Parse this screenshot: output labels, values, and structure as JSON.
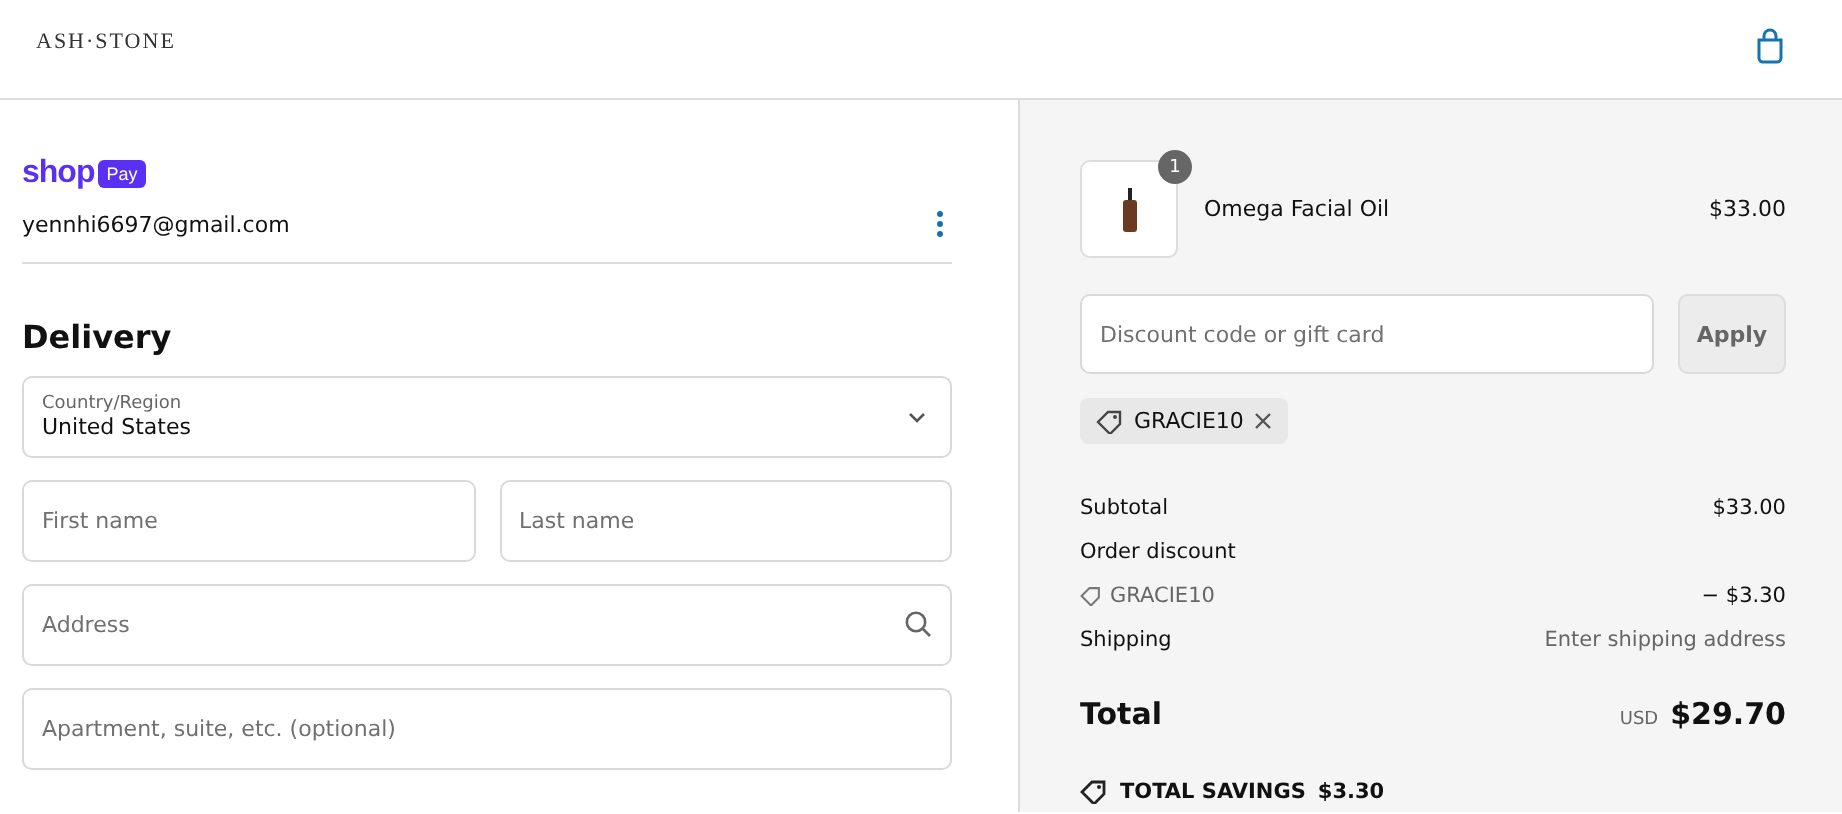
{
  "header": {
    "logo": "ASH·STONE"
  },
  "account": {
    "wallet_word": "shop",
    "wallet_badge": "Pay",
    "email": "yennhi6697@gmail.com"
  },
  "delivery": {
    "title": "Delivery",
    "fields": [
      {
        "kind": "select",
        "label": "Country/Region",
        "value": "United States"
      },
      {
        "kind": "pair",
        "items": [
          {
            "placeholder": "First name"
          },
          {
            "placeholder": "Last name"
          }
        ]
      },
      {
        "kind": "search",
        "placeholder": "Address"
      },
      {
        "kind": "text",
        "placeholder": "Apartment, suite, etc. (optional)"
      }
    ]
  },
  "summary": {
    "item": {
      "name": "Omega Facial Oil",
      "price": "$33.00",
      "quantity": "1"
    },
    "discount": {
      "placeholder": "Discount code or gift card",
      "button": "Apply",
      "applied_code": "GRACIE10"
    },
    "lines": [
      {
        "kind": "plain",
        "label": "Subtotal",
        "value": "$33.00"
      },
      {
        "kind": "heading",
        "label": "Order discount"
      },
      {
        "kind": "code",
        "label": "GRACIE10",
        "value": "− $3.30"
      },
      {
        "kind": "muted",
        "label": "Shipping",
        "value": "Enter shipping address"
      }
    ],
    "total": {
      "label": "Total",
      "currency": "USD",
      "amount": "$29.70"
    },
    "savings": {
      "label": "TOTAL SAVINGS",
      "amount": "$3.30"
    }
  }
}
